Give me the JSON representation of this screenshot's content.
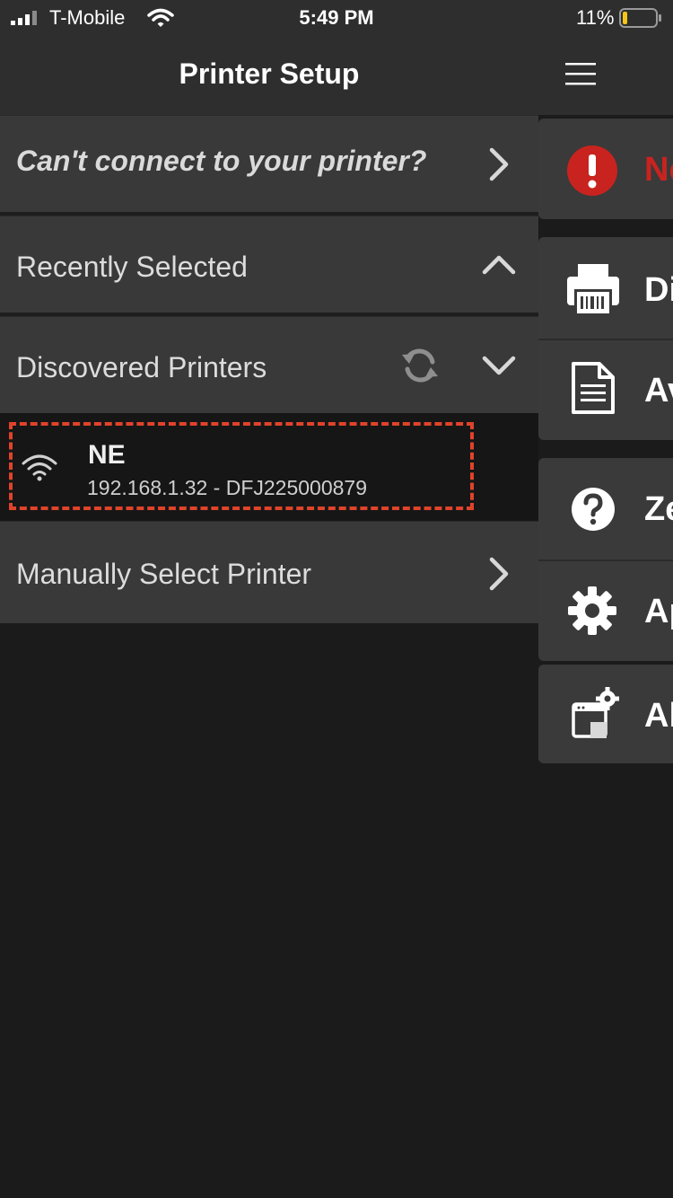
{
  "status_bar": {
    "carrier": "T-Mobile",
    "time": "5:49 PM",
    "battery_percent": "11%"
  },
  "nav": {
    "title": "Printer Setup",
    "menu_icon": "hamburger-icon"
  },
  "rows": {
    "cant_connect": "Can't connect to your printer?",
    "recently_selected": "Recently Selected",
    "discovered_printers": "Discovered Printers",
    "manually_select": "Manually Select Printer"
  },
  "printer": {
    "name": "NE",
    "address": "192.168.1.32 - DFJ225000879",
    "icon": "wifi-icon"
  },
  "drawer": {
    "items": [
      {
        "text": "Ne",
        "icon": "error-icon",
        "color": "#c9231f"
      },
      {
        "text": "Di",
        "icon": "printer-icon"
      },
      {
        "text": "Av",
        "icon": "document-icon"
      },
      {
        "text": "Ze",
        "icon": "help-icon"
      },
      {
        "text": "Ap",
        "icon": "gear-icon"
      },
      {
        "text": "Al",
        "icon": "window-settings-icon"
      }
    ]
  },
  "colors": {
    "accent_dashed": "#e0432a",
    "error_red": "#c9231f"
  }
}
